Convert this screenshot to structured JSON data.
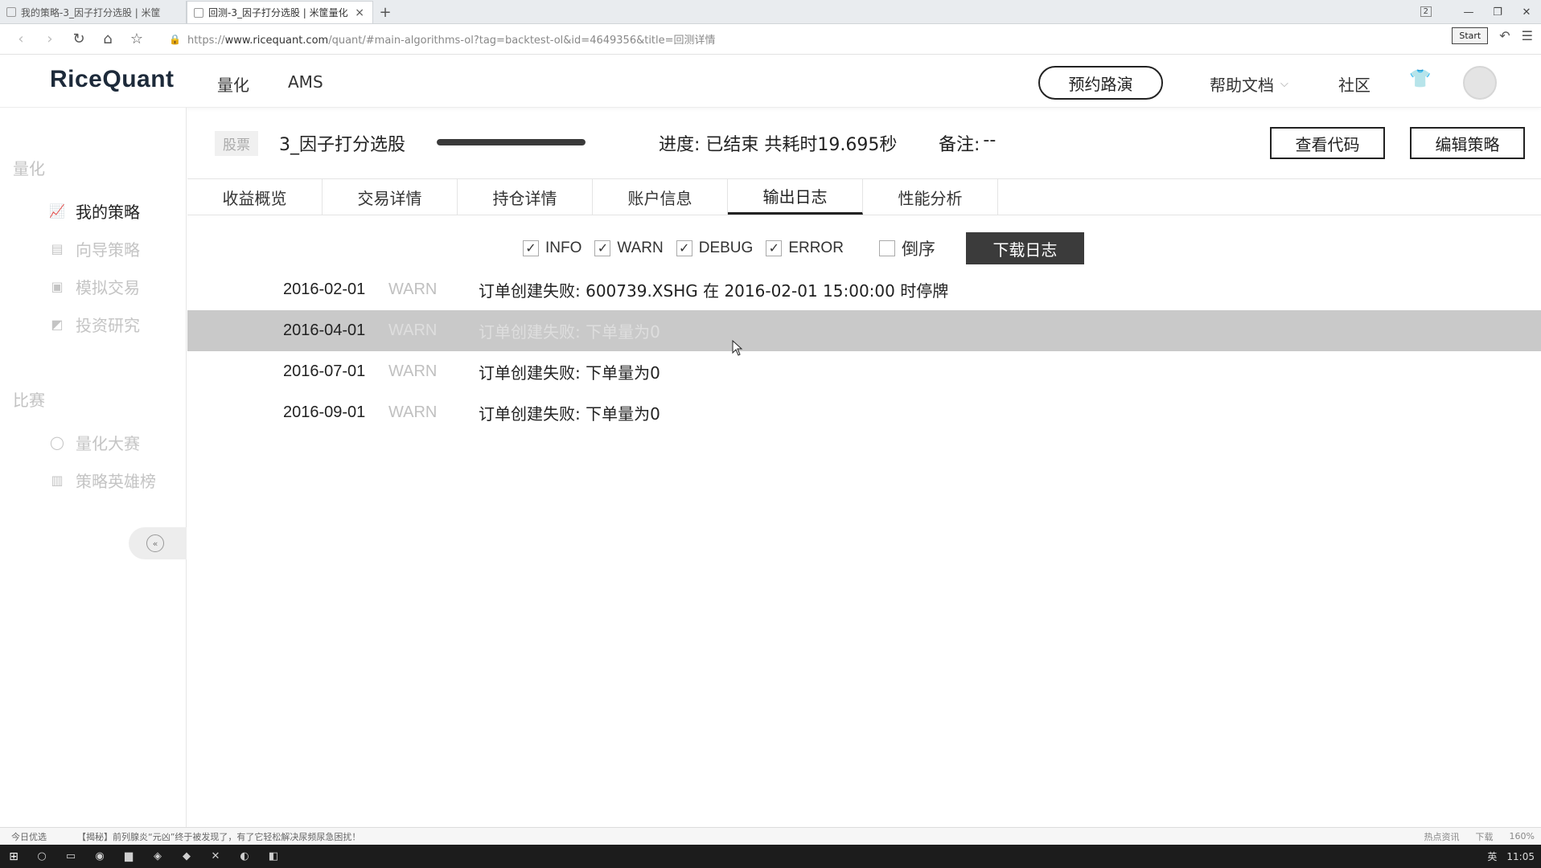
{
  "browser": {
    "tabs": [
      {
        "title": "我的策略-3_因子打分选股 | 米筐",
        "active": false
      },
      {
        "title": "回测-3_因子打分选股 | 米筐量化",
        "active": true
      }
    ],
    "new_tab": "+",
    "tab_count": "2",
    "url_prefix": "https://",
    "url_domain": "www.ricequant.com",
    "url_path": "/quant/#main-algorithms-ol?tag=backtest-ol&id=4649356&title=回测详情",
    "start_label": "Start"
  },
  "header": {
    "logo": "RiceQuant",
    "nav": [
      "量化",
      "AMS"
    ],
    "roadshow_button": "预约路演",
    "help_docs": "帮助文档",
    "community": "社区"
  },
  "sidebar": {
    "section_quant": "量化",
    "items_quant": [
      {
        "label": "我的策略",
        "icon": "chart-icon",
        "glyph": "📈",
        "active": true
      },
      {
        "label": "向导策略",
        "icon": "wizard-icon",
        "glyph": "▤",
        "active": false
      },
      {
        "label": "模拟交易",
        "icon": "trade-icon",
        "glyph": "▣",
        "active": false
      },
      {
        "label": "投资研究",
        "icon": "research-icon",
        "glyph": "◩",
        "active": false
      }
    ],
    "section_contest": "比赛",
    "items_contest": [
      {
        "label": "量化大赛",
        "icon": "bulb-icon",
        "glyph": "◯",
        "active": false
      },
      {
        "label": "策略英雄榜",
        "icon": "leaderboard-icon",
        "glyph": "▥",
        "active": false
      }
    ],
    "collapse_glyph": "«"
  },
  "backtest": {
    "type_badge": "股票",
    "name": "3_因子打分选股",
    "progress": 1.0,
    "progress_text": "进度: 已结束 共耗时19.695秒",
    "remark_label": "备注:",
    "remark_value": "--",
    "view_code": "查看代码",
    "edit_strategy": "编辑策略"
  },
  "tabs": [
    "收益概览",
    "交易详情",
    "持仓详情",
    "账户信息",
    "输出日志",
    "性能分析"
  ],
  "active_tab": 4,
  "filters": {
    "info": "INFO",
    "warn": "WARN",
    "debug": "DEBUG",
    "error": "ERROR",
    "reverse": "倒序",
    "download": "下载日志",
    "check": "✓"
  },
  "logs": [
    {
      "date": "2016-02-01",
      "level": "WARN",
      "message": "订单创建失败: 600739.XSHG 在 2016-02-01 15:00:00 时停牌"
    },
    {
      "date": "2016-04-01",
      "level": "WARN",
      "message": "订单创建失败: 下单量为0"
    },
    {
      "date": "2016-07-01",
      "level": "WARN",
      "message": "订单创建失败: 下单量为0"
    },
    {
      "date": "2016-09-01",
      "level": "WARN",
      "message": "订单创建失败: 下单量为0"
    }
  ],
  "statusbar": {
    "today": "今日优选",
    "news": "【揭秘】前列腺炎“元凶”终于被发现了，有了它轻松解决尿频尿急困扰！",
    "right": [
      "热点资讯",
      "下载",
      "160%"
    ]
  },
  "taskbar": {
    "clock": "11:05",
    "ime": "英"
  }
}
